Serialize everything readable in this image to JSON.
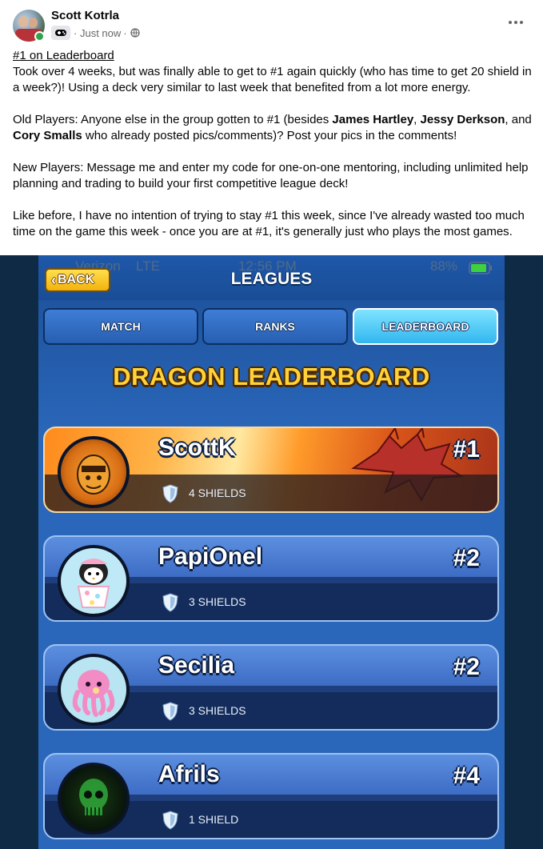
{
  "post": {
    "author": "Scott Kotrla",
    "timestamp": "Just now",
    "separator": "·",
    "icons": {
      "badge": "game-controller-icon",
      "privacy": "globe-icon",
      "menu": "more-options-icon"
    },
    "title": "#1 on Leaderboard",
    "p1": "Took over 4 weeks, but was finally able to get to #1 again quickly (who has time to get 20 shield in a week?)! Using a deck very similar to last week that benefited from a lot more energy.",
    "p2_start": "Old Players: Anyone else in the group gotten to #1 (besides ",
    "p2_name1": "James Hartley",
    "p2_comma1": ", ",
    "p2_name2": "Jessy Derkson",
    "p2_and": ", and ",
    "p2_name3": "Cory Smalls",
    "p2_end": " who already posted pics/comments)? Post your pics in the comments!",
    "p3": "New Players: Message me and enter my code for one-on-one mentoring, including unlimited help planning and trading to build your first competitive league deck!",
    "p4": "Like before, I have no intention of trying to stay #1 this week, since I've already wasted too much time on the game this week - once you are at #1, it's generally just who plays the most games."
  },
  "screenshot": {
    "status": {
      "carrier": "Verizon",
      "network": "LTE",
      "time": "12:56 PM",
      "battery": "88%"
    },
    "back_label": "BACK",
    "page_title": "LEAGUES",
    "tabs": [
      {
        "label": "MATCH",
        "active": false
      },
      {
        "label": "RANKS",
        "active": false
      },
      {
        "label": "LEADERBOARD",
        "active": true
      }
    ],
    "board_title": "DRAGON LEADERBOARD",
    "players": [
      {
        "name": "ScottK",
        "rank": "#1",
        "shields": "4 SHIELDS"
      },
      {
        "name": "PapiOnel",
        "rank": "#2",
        "shields": "3 SHIELDS"
      },
      {
        "name": "Secilia",
        "rank": "#2",
        "shields": "3 SHIELDS"
      },
      {
        "name": "Afrils",
        "rank": "#4",
        "shields": "1 SHIELD"
      }
    ],
    "colors": {
      "accent": "#ffd23a",
      "active_tab": "#32b6ef",
      "panel": "#2a66b9"
    }
  }
}
